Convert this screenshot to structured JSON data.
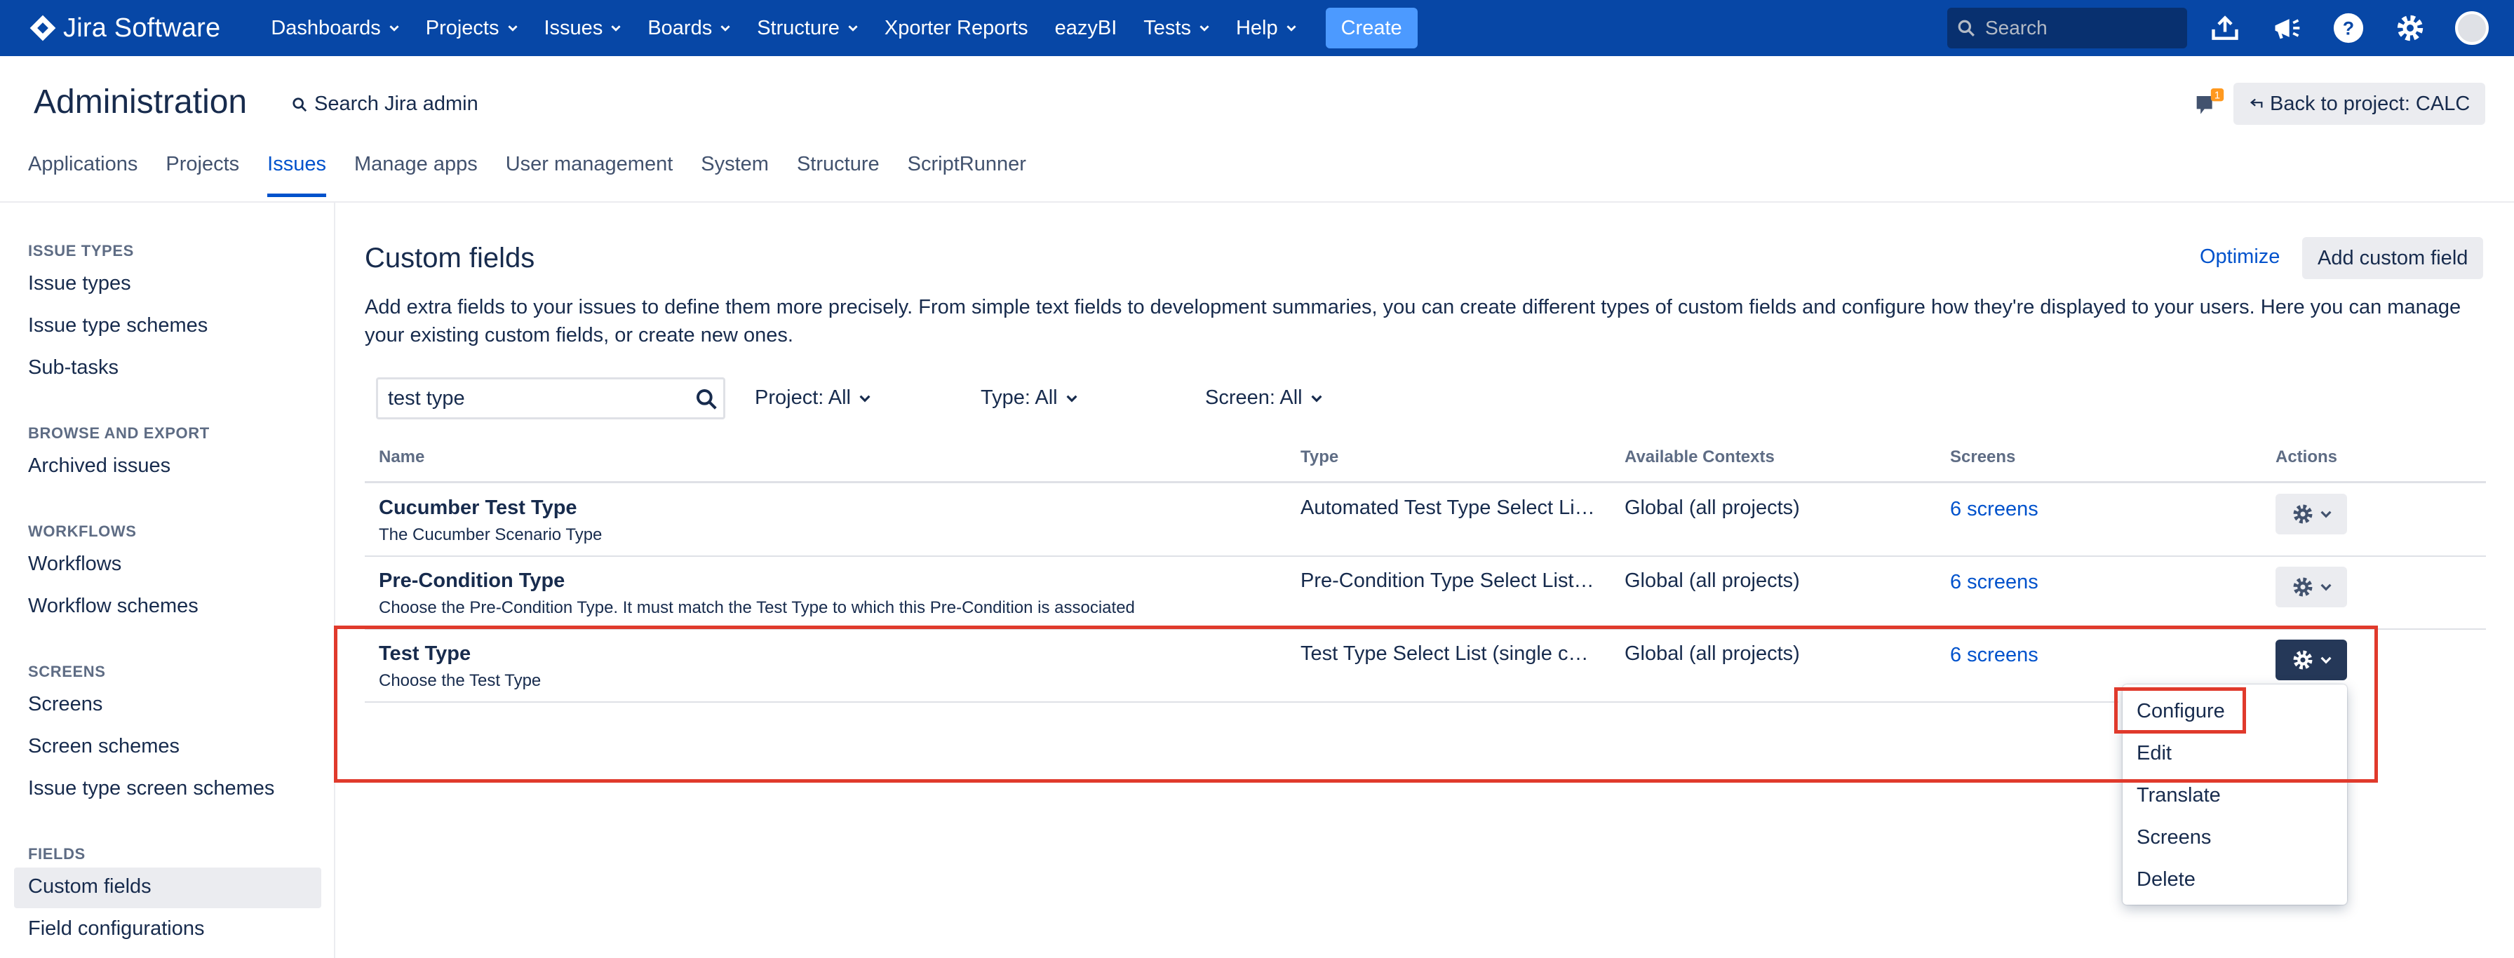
{
  "topbar": {
    "logo_text": "Jira Software",
    "nav": [
      "Dashboards",
      "Projects",
      "Issues",
      "Boards",
      "Structure",
      "Xporter Reports",
      "eazyBI",
      "Tests",
      "Help"
    ],
    "create_label": "Create",
    "search_placeholder": "Search",
    "bg_color": "#0747a6"
  },
  "admin": {
    "title": "Administration",
    "search_label": "Search Jira admin",
    "notification_count": "1",
    "back_label": "Back to project: CALC"
  },
  "tabs": [
    "Applications",
    "Projects",
    "Issues",
    "Manage apps",
    "User management",
    "System",
    "Structure",
    "ScriptRunner"
  ],
  "active_tab": "Issues",
  "sidebar": {
    "sections": [
      {
        "heading": "ISSUE TYPES",
        "items": [
          "Issue types",
          "Issue type schemes",
          "Sub-tasks"
        ]
      },
      {
        "heading": "BROWSE AND EXPORT",
        "items": [
          "Archived issues"
        ]
      },
      {
        "heading": "WORKFLOWS",
        "items": [
          "Workflows",
          "Workflow schemes"
        ]
      },
      {
        "heading": "SCREENS",
        "items": [
          "Screens",
          "Screen schemes",
          "Issue type screen schemes"
        ]
      },
      {
        "heading": "FIELDS",
        "items": [
          "Custom fields",
          "Field configurations"
        ]
      }
    ],
    "active_item": "Custom fields"
  },
  "main": {
    "title": "Custom fields",
    "optimize_label": "Optimize",
    "add_label": "Add custom field",
    "description": "Add extra fields to your issues to define them more precisely. From simple text fields to development summaries, you can create different types of custom fields and configure how they're displayed to your users. Here you can manage your existing custom fields, or create new ones.",
    "filter_value": "test type",
    "filters": {
      "project": "Project: All",
      "type": "Type: All",
      "screen": "Screen: All"
    },
    "columns": [
      "Name",
      "Type",
      "Available Contexts",
      "Screens",
      "Actions"
    ],
    "rows": [
      {
        "name": "Cucumber Test Type",
        "description": "The Cucumber Scenario Type",
        "type": "Automated Test Type Select Li…",
        "contexts": "Global (all projects)",
        "screens": "6 screens"
      },
      {
        "name": "Pre-Condition Type",
        "description": "Choose the Pre-Condition Type. It must match the Test Type to which this Pre-Condition is associated",
        "type": "Pre-Condition Type Select List…",
        "contexts": "Global (all projects)",
        "screens": "6 screens"
      },
      {
        "name": "Test Type",
        "description": "Choose the Test Type",
        "type": "Test Type Select List (single c…",
        "contexts": "Global (all projects)",
        "screens": "6 screens"
      }
    ],
    "actions_menu": [
      "Configure",
      "Edit",
      "Translate",
      "Screens",
      "Delete"
    ]
  },
  "colors": {
    "link": "#0052cc",
    "highlight": "#e03a2c",
    "text": "#172b4d"
  }
}
